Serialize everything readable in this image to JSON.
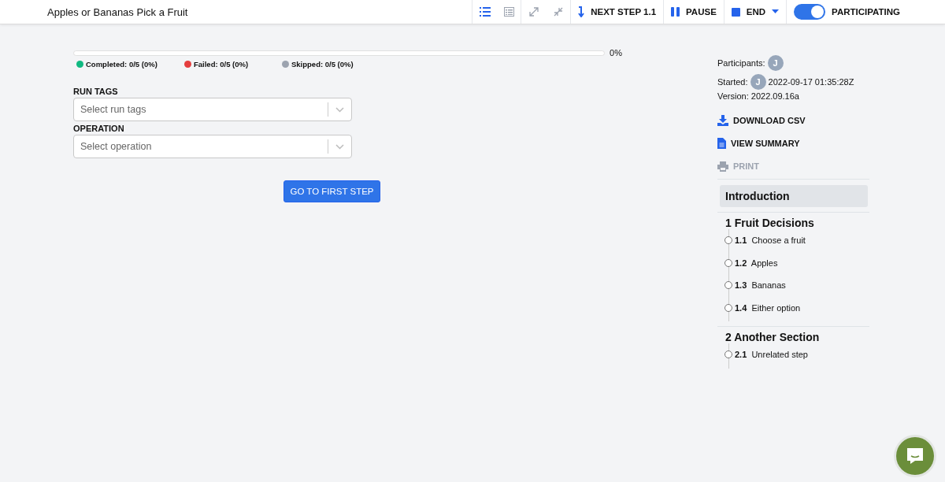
{
  "window": {
    "title": "Apples or Bananas Pick a Fruit"
  },
  "toolbar": {
    "view_buttons": [
      {
        "kind": "list",
        "selected": true
      },
      {
        "kind": "table",
        "selected": false
      },
      {
        "kind": "expand",
        "selected": false
      },
      {
        "kind": "collapse",
        "selected": false
      }
    ],
    "next_step": "NEXT STEP 1.1",
    "pause": "PAUSE",
    "end": "END",
    "participating": {
      "label": "PARTICIPATING",
      "on": true
    }
  },
  "progress": {
    "level": 0,
    "reading": "0%",
    "legend": [
      {
        "label": "Completed: 0/5 (0%)",
        "color": "#10b981"
      },
      {
        "label": "Failed: 0/5 (0%)",
        "color": "#e53e3e"
      },
      {
        "label": "Skipped: 0/5 (0%)",
        "color": "#9ca3af"
      }
    ]
  },
  "fields": [
    {
      "label": "RUN TAGS",
      "placeholder": "Select run tags"
    },
    {
      "label": "OPERATION",
      "placeholder": "Select operation"
    }
  ],
  "start_button": "GO TO FIRST STEP",
  "sidebar": {
    "participants_label": "Participants:",
    "participants": [
      "J"
    ],
    "started_label": "Started:",
    "started_avatar": "J",
    "started_time": "2022-09-17 01:35:28Z",
    "version": "Version: 2022.09.16a",
    "actions": [
      {
        "kind": "download",
        "label": "DOWNLOAD CSV",
        "disabled": false
      },
      {
        "kind": "summary",
        "label": "VIEW SUMMARY",
        "disabled": false
      },
      {
        "kind": "print",
        "label": "PRINT",
        "disabled": true
      }
    ],
    "intro": {
      "label": "Introduction",
      "selected": true
    },
    "sections": [
      {
        "title": "1 Fruit Decisions",
        "steps": [
          {
            "number": "1.1",
            "label": "Choose a fruit"
          },
          {
            "number": "1.2",
            "label": "Apples"
          },
          {
            "number": "1.3",
            "label": "Bananas"
          },
          {
            "number": "1.4",
            "label": "Either option"
          }
        ]
      },
      {
        "title": "2 Another Section",
        "steps": [
          {
            "number": "2.1",
            "label": "Unrelated step"
          }
        ]
      }
    ]
  }
}
